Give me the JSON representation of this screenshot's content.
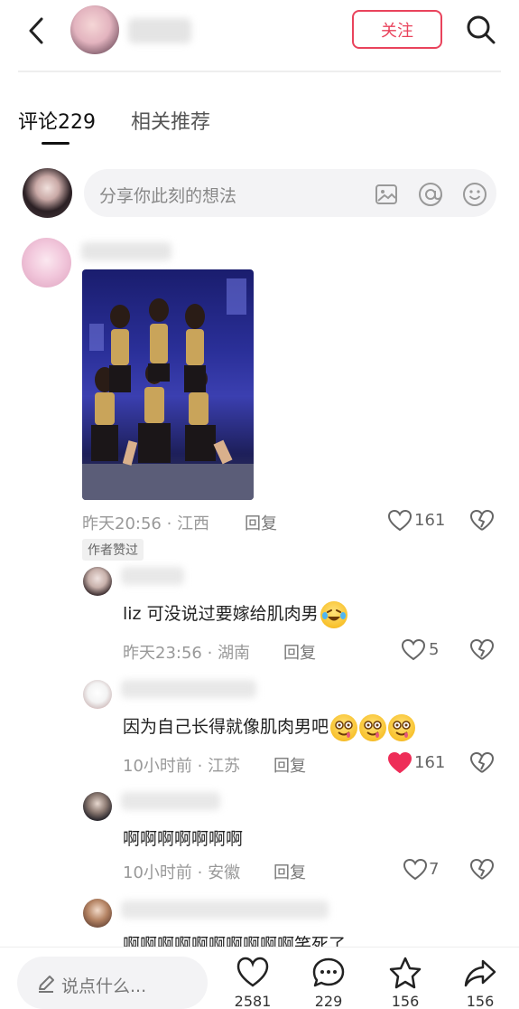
{
  "header": {
    "follow_label": "关注"
  },
  "tabs": [
    {
      "label": "评论229",
      "active": true
    },
    {
      "label": "相关推荐",
      "active": false
    }
  ],
  "share_input": {
    "placeholder": "分享你此刻的想法"
  },
  "comments": [
    {
      "time": "昨天20:56",
      "location": "江西",
      "reply_label": "回复",
      "likes": "161",
      "badge": "作者赞过",
      "replies": [
        {
          "text": "liz 可没说过要嫁给肌肉男",
          "time": "昨天23:56",
          "location": "湖南",
          "reply_label": "回复",
          "likes": "5",
          "liked": false
        },
        {
          "text": "因为自己长得就像肌肉男吧",
          "time": "10小时前",
          "location": "江苏",
          "reply_label": "回复",
          "likes": "161",
          "liked": true
        },
        {
          "text": "啊啊啊啊啊啊啊",
          "time": "10小时前",
          "location": "安徽",
          "reply_label": "回复",
          "likes": "7",
          "liked": false
        },
        {
          "text": "啊啊啊啊啊啊啊啊啊啊笑死了"
        }
      ]
    }
  ],
  "bottom_bar": {
    "say_placeholder": "说点什么...",
    "likes": "2581",
    "comments": "229",
    "favorites": "156",
    "shares": "156"
  },
  "colors": {
    "accent": "#e9435c",
    "muted": "#999999"
  }
}
